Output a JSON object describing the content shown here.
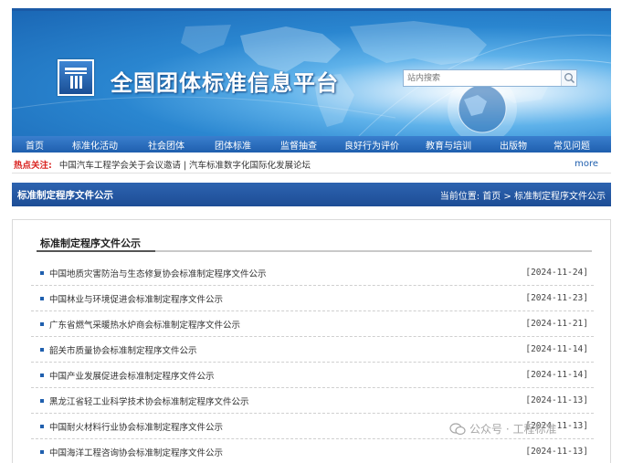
{
  "header": {
    "site_title": "全国团体标准信息平台",
    "search_placeholder": "站内搜索"
  },
  "nav": {
    "items": [
      "首页",
      "标准化活动",
      "社会团体",
      "团体标准",
      "监督抽查",
      "良好行为评价",
      "教育与培训",
      "出版物",
      "常见问题"
    ]
  },
  "hotbar": {
    "label": "热点关注:",
    "text": "中国汽车工程学会关于会议邀请 | 汽车标准数字化国际化发展论坛",
    "more": "more"
  },
  "location": {
    "title": "标准制定程序文件公示",
    "breadcrumb": "当前位置: 首页 > 标准制定程序文件公示"
  },
  "section": {
    "title": "标准制定程序文件公示"
  },
  "list": [
    {
      "title": "中国地质灾害防治与生态修复协会标准制定程序文件公示",
      "date": "[2024-11-24]"
    },
    {
      "title": "中国林业与环境促进会标准制定程序文件公示",
      "date": "[2024-11-23]"
    },
    {
      "title": "广东省燃气采暖热水炉商会标准制定程序文件公示",
      "date": "[2024-11-21]"
    },
    {
      "title": "韶关市质量协会标准制定程序文件公示",
      "date": "[2024-11-14]"
    },
    {
      "title": "中国产业发展促进会标准制定程序文件公示",
      "date": "[2024-11-14]"
    },
    {
      "title": "黑龙江省轻工业科学技术协会标准制定程序文件公示",
      "date": "[2024-11-13]"
    },
    {
      "title": "中国耐火材料行业协会标准制定程序文件公示",
      "date": "[2024-11-13]"
    },
    {
      "title": "中国海洋工程咨询协会标准制定程序文件公示",
      "date": "[2024-11-13]"
    }
  ],
  "watermark": "公众号 · 工程标准",
  "colors": {
    "primary": "#1f5fae",
    "hot": "#d9221f"
  }
}
